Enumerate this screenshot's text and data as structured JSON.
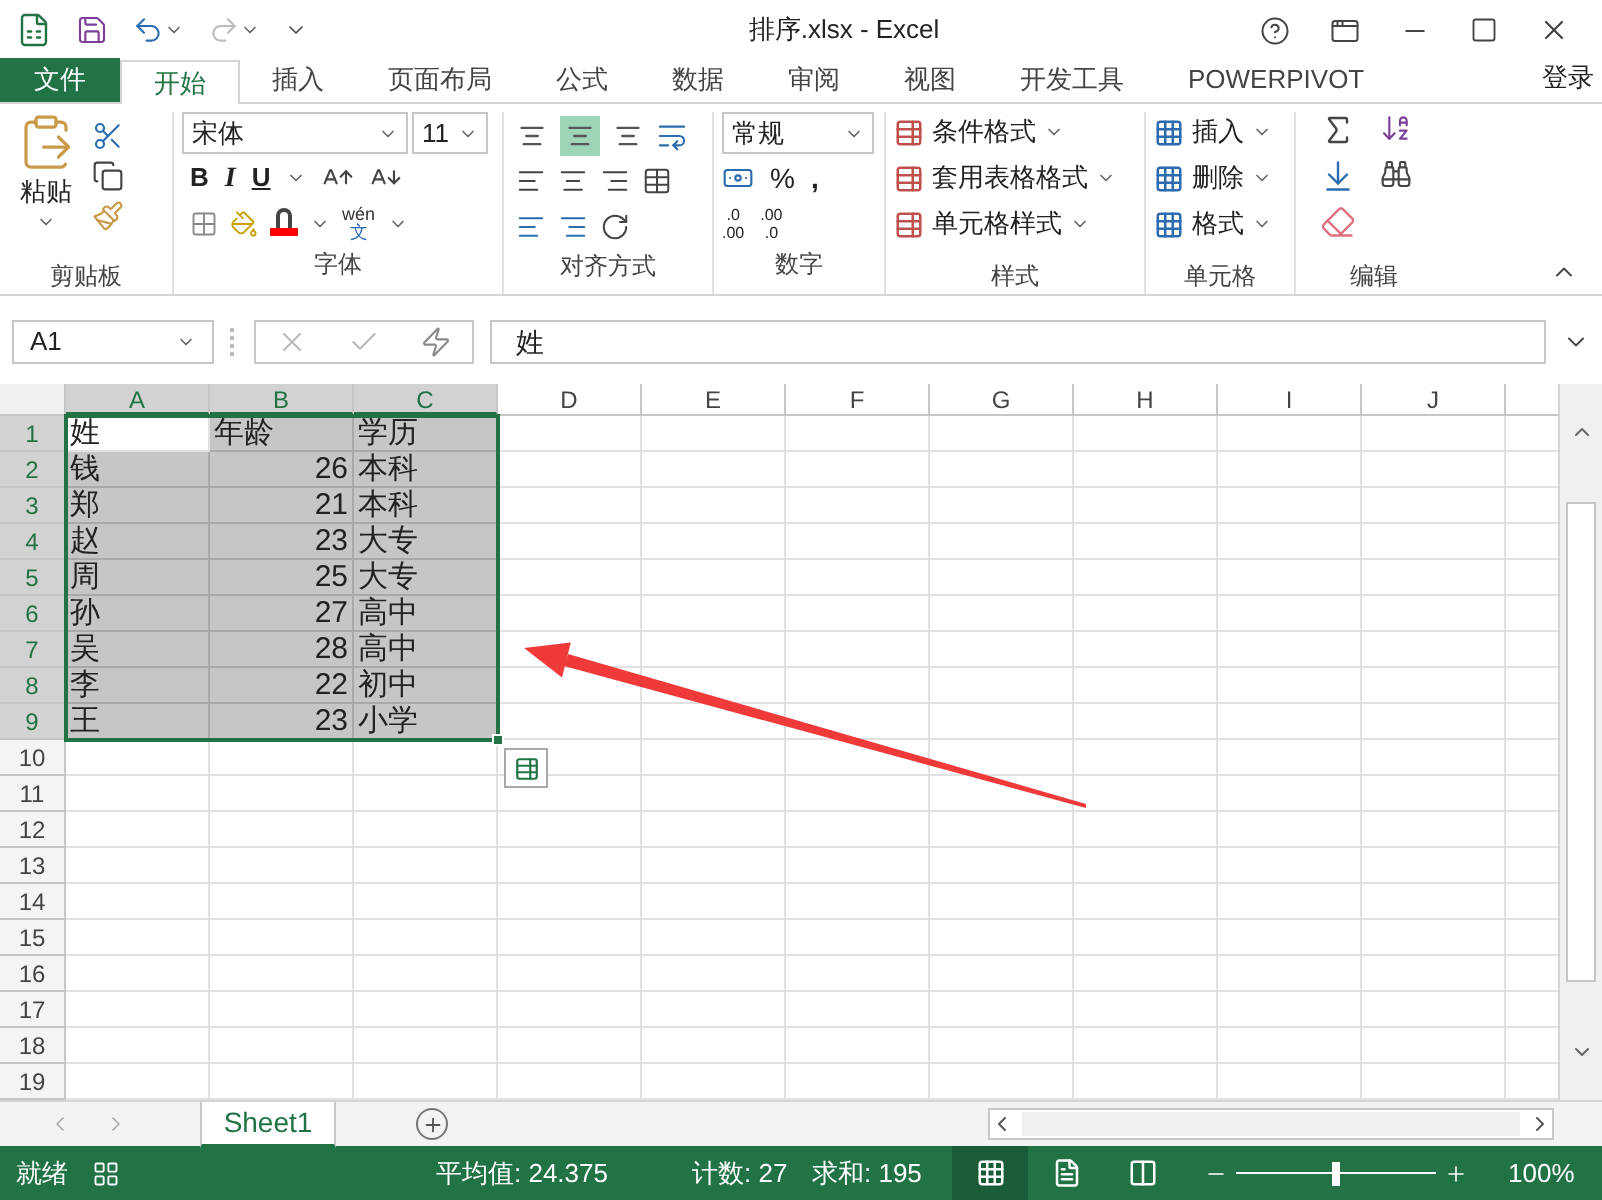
{
  "title_bar": {
    "title": "排序.xlsx - Excel"
  },
  "tabs": [
    {
      "label": "文件",
      "kind": "file",
      "selected": false
    },
    {
      "label": "开始",
      "kind": "tab",
      "selected": true
    },
    {
      "label": "插入",
      "kind": "tab",
      "selected": false
    },
    {
      "label": "页面布局",
      "kind": "tab",
      "selected": false
    },
    {
      "label": "公式",
      "kind": "tab",
      "selected": false
    },
    {
      "label": "数据",
      "kind": "tab",
      "selected": false
    },
    {
      "label": "审阅",
      "kind": "tab",
      "selected": false
    },
    {
      "label": "视图",
      "kind": "tab",
      "selected": false
    },
    {
      "label": "开发工具",
      "kind": "tab",
      "selected": false
    },
    {
      "label": "POWERPIVOT",
      "kind": "tab",
      "selected": false
    }
  ],
  "sign_in": "登录",
  "ribbon": {
    "clipboard": {
      "paste": "粘贴",
      "label": "剪贴板"
    },
    "font": {
      "name": "宋体",
      "size": "11",
      "bold": "B",
      "italic": "I",
      "underline": "U",
      "phonetic_top": "wén",
      "phonetic_bottom": "文",
      "label": "字体"
    },
    "alignment": {
      "label": "对齐方式",
      "vertical": [
        {
          "selected": false
        },
        {
          "selected": true
        },
        {
          "selected": false
        }
      ]
    },
    "number": {
      "format": "常规",
      "percent": "%",
      "comma": ",",
      "decimals": [
        {
          "top": ".0",
          "bottom": ".00"
        },
        {
          "top": ".00",
          "bottom": ".0"
        }
      ],
      "label": "数字"
    },
    "styles": {
      "label": "样式",
      "items": [
        "条件格式",
        "套用表格格式",
        "单元格样式"
      ]
    },
    "cells": {
      "label": "单元格",
      "items": [
        "插入",
        "删除",
        "格式"
      ]
    },
    "editing": {
      "label": "编辑"
    }
  },
  "name_box": "A1",
  "formula": "姓",
  "columns": [
    {
      "label": "A",
      "selected": true
    },
    {
      "label": "B",
      "selected": true
    },
    {
      "label": "C",
      "selected": true
    },
    {
      "label": "D",
      "selected": false
    },
    {
      "label": "E",
      "selected": false
    },
    {
      "label": "F",
      "selected": false
    },
    {
      "label": "G",
      "selected": false
    },
    {
      "label": "H",
      "selected": false
    },
    {
      "label": "I",
      "selected": false
    },
    {
      "label": "J",
      "selected": false
    }
  ],
  "rows": [
    {
      "label": "1",
      "selected": true,
      "cells": [
        {
          "text": "姓",
          "kind": "text"
        },
        {
          "text": "年龄",
          "kind": "text"
        },
        {
          "text": "学历",
          "kind": "text"
        }
      ]
    },
    {
      "label": "2",
      "selected": true,
      "cells": [
        {
          "text": "钱",
          "kind": "text"
        },
        {
          "text": "26",
          "kind": "number"
        },
        {
          "text": "本科",
          "kind": "text"
        }
      ]
    },
    {
      "label": "3",
      "selected": true,
      "cells": [
        {
          "text": "郑",
          "kind": "text"
        },
        {
          "text": "21",
          "kind": "number"
        },
        {
          "text": "本科",
          "kind": "text"
        }
      ]
    },
    {
      "label": "4",
      "selected": true,
      "cells": [
        {
          "text": "赵",
          "kind": "text"
        },
        {
          "text": "23",
          "kind": "number"
        },
        {
          "text": "大专",
          "kind": "text"
        }
      ]
    },
    {
      "label": "5",
      "selected": true,
      "cells": [
        {
          "text": "周",
          "kind": "text"
        },
        {
          "text": "25",
          "kind": "number"
        },
        {
          "text": "大专",
          "kind": "text"
        }
      ]
    },
    {
      "label": "6",
      "selected": true,
      "cells": [
        {
          "text": "孙",
          "kind": "text"
        },
        {
          "text": "27",
          "kind": "number"
        },
        {
          "text": "高中",
          "kind": "text"
        }
      ]
    },
    {
      "label": "7",
      "selected": true,
      "cells": [
        {
          "text": "吴",
          "kind": "text"
        },
        {
          "text": "28",
          "kind": "number"
        },
        {
          "text": "高中",
          "kind": "text"
        }
      ]
    },
    {
      "label": "8",
      "selected": true,
      "cells": [
        {
          "text": "李",
          "kind": "text"
        },
        {
          "text": "22",
          "kind": "number"
        },
        {
          "text": "初中",
          "kind": "text"
        }
      ]
    },
    {
      "label": "9",
      "selected": true,
      "cells": [
        {
          "text": "王",
          "kind": "text"
        },
        {
          "text": "23",
          "kind": "number"
        },
        {
          "text": "小学",
          "kind": "text"
        }
      ]
    },
    {
      "label": "10",
      "selected": false
    },
    {
      "label": "11",
      "selected": false
    },
    {
      "label": "12",
      "selected": false
    },
    {
      "label": "13",
      "selected": false
    },
    {
      "label": "14",
      "selected": false
    },
    {
      "label": "15",
      "selected": false
    },
    {
      "label": "16",
      "selected": false
    },
    {
      "label": "17",
      "selected": false
    },
    {
      "label": "18",
      "selected": false
    },
    {
      "label": "19",
      "selected": false
    }
  ],
  "sheet_tabs": [
    {
      "label": "Sheet1",
      "selected": true
    }
  ],
  "status_bar": {
    "ready": "就绪",
    "average": "平均值: 24.375",
    "count": "计数: 27",
    "sum": "求和: 195",
    "view_buttons": [
      {
        "selected": true
      },
      {
        "selected": false
      },
      {
        "selected": false
      }
    ],
    "zoom": {
      "level": 0.5,
      "reading": "100%"
    }
  }
}
